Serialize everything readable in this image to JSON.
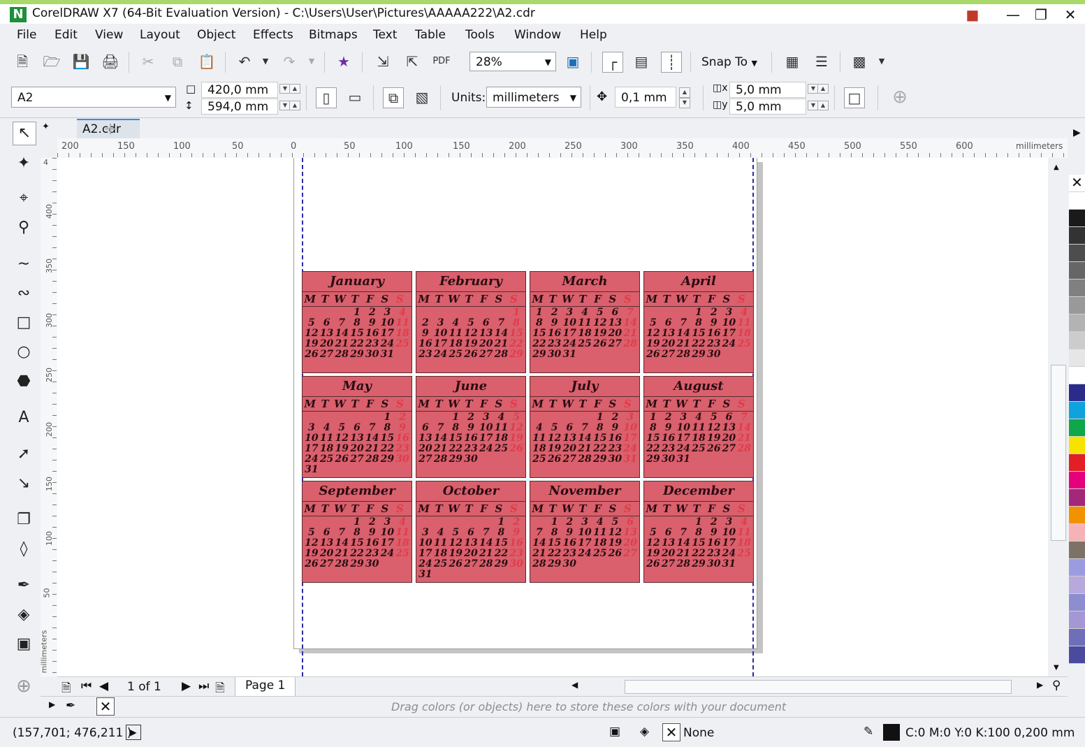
{
  "titlebar": {
    "title": "CorelDRAW X7 (64-Bit Evaluation Version) - C:\\Users\\User\\Pictures\\AAAAA222\\A2.cdr",
    "logo": "N"
  },
  "menu": [
    "File",
    "Edit",
    "View",
    "Layout",
    "Object",
    "Effects",
    "Bitmaps",
    "Text",
    "Table",
    "Tools",
    "Window",
    "Help"
  ],
  "toolbar": {
    "zoom": "28%",
    "snap_to": "Snap To"
  },
  "propbar": {
    "page_size": "A2",
    "width": "420,0 mm",
    "height": "594,0 mm",
    "units_label": "Units:",
    "units": "millimeters",
    "nudge": "0,1 mm",
    "dup_x": "5,0 mm",
    "dup_y": "5,0 mm"
  },
  "document_tab": "A2.cdr",
  "rulers": {
    "horizontal": [
      "200",
      "150",
      "100",
      "50",
      "0",
      "50",
      "100",
      "150",
      "200",
      "250",
      "300",
      "350",
      "400",
      "450",
      "500",
      "550",
      "600",
      "millimeters"
    ],
    "vertical": [
      "4",
      "400",
      "350",
      "300",
      "250",
      "200",
      "150",
      "100",
      "50",
      "millimeters"
    ]
  },
  "page_nav": {
    "counter": "1 of 1",
    "page_tab": "Page 1"
  },
  "doc_palette_hint": "Drag colors (or objects) here to store these colors with your document",
  "status": {
    "coords": "(157,701; 476,211 )",
    "fill_label": "None",
    "outline": "C:0 M:0 Y:0 K:100  0,200 mm"
  },
  "colors": {
    "calendar_fill": "#d9606c",
    "sunday": "#e43a48",
    "accent": "#3b8ad9"
  },
  "palette": [
    "#ffffff",
    "#1a1a1a",
    "#333333",
    "#4d4d4d",
    "#666666",
    "#808080",
    "#999999",
    "#b3b3b3",
    "#cccccc",
    "#e6e6e6",
    "#ffffff",
    "#2b2b8c",
    "#0fa3dd",
    "#10a64a",
    "#f6e400",
    "#e31e24",
    "#e6007e",
    "#a3287a",
    "#f39200",
    "#f6b3b5",
    "#7c7266",
    "#9b9ce0",
    "#b7a9dc",
    "#8d8ecf",
    "#a596d4",
    "#6e6fb8",
    "#4a4b9e"
  ],
  "weekdays": [
    "M",
    "T",
    "W",
    "T",
    "F",
    "S",
    "S"
  ],
  "calendar": [
    {
      "name": "January",
      "offset": 3,
      "days": 31
    },
    {
      "name": "February",
      "offset": 6,
      "days": 29
    },
    {
      "name": "March",
      "offset": 0,
      "days": 31
    },
    {
      "name": "April",
      "offset": 3,
      "days": 30
    },
    {
      "name": "May",
      "offset": 5,
      "days": 31
    },
    {
      "name": "June",
      "offset": 2,
      "days": 30
    },
    {
      "name": "July",
      "offset": 4,
      "days": 31
    },
    {
      "name": "August",
      "offset": 0,
      "days": 31
    },
    {
      "name": "September",
      "offset": 3,
      "days": 30
    },
    {
      "name": "October",
      "offset": 5,
      "days": 31
    },
    {
      "name": "November",
      "offset": 1,
      "days": 30
    },
    {
      "name": "December",
      "offset": 3,
      "days": 31
    }
  ]
}
